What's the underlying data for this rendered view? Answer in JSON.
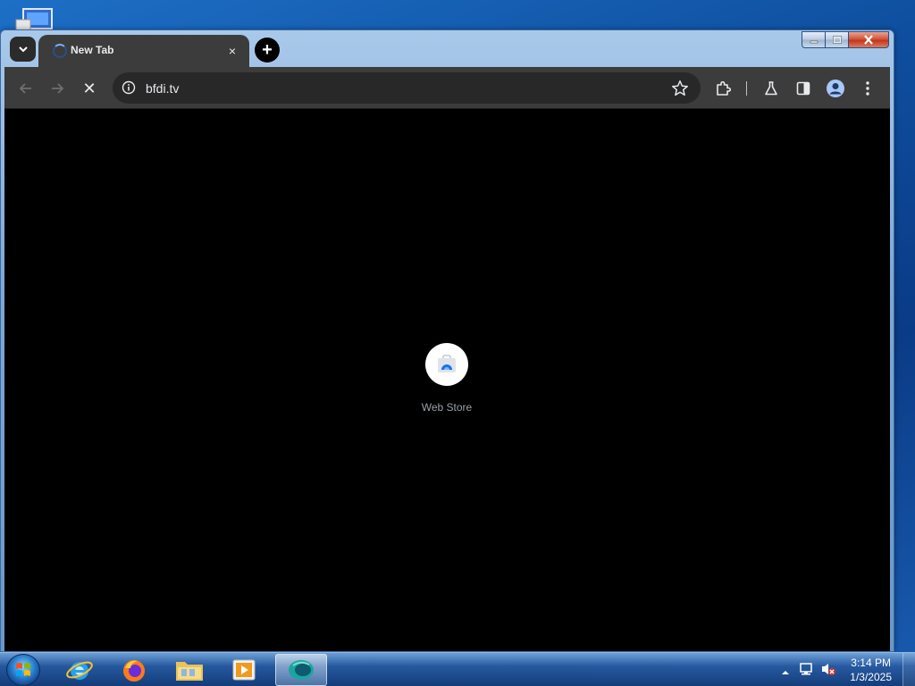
{
  "browser": {
    "tab": {
      "title": "New Tab",
      "close_glyph": "×"
    },
    "new_tab_glyph": "+",
    "toolbar": {
      "reload_stop_glyph": "✕"
    },
    "omnibox": {
      "url": "bfdi.tv"
    }
  },
  "content": {
    "shortcuts": [
      {
        "label": "Web Store",
        "icon": "web-store-icon"
      }
    ]
  },
  "taskbar": {
    "items": [
      {
        "name": "internet-explorer",
        "icon": "internet-explorer-icon"
      },
      {
        "name": "firefox",
        "icon": "firefox-icon"
      },
      {
        "name": "file-explorer",
        "icon": "folder-icon"
      },
      {
        "name": "media-player",
        "icon": "media-player-icon"
      },
      {
        "name": "browser",
        "icon": "browser-icon",
        "active": true
      }
    ],
    "clock": {
      "time": "3:14 PM",
      "date": "1/3/2025"
    }
  },
  "colors": {
    "toolbar_bg": "#3c3c3c",
    "omnibox_bg": "#282828",
    "content_bg": "#000000",
    "text_light": "#e8eaed"
  }
}
